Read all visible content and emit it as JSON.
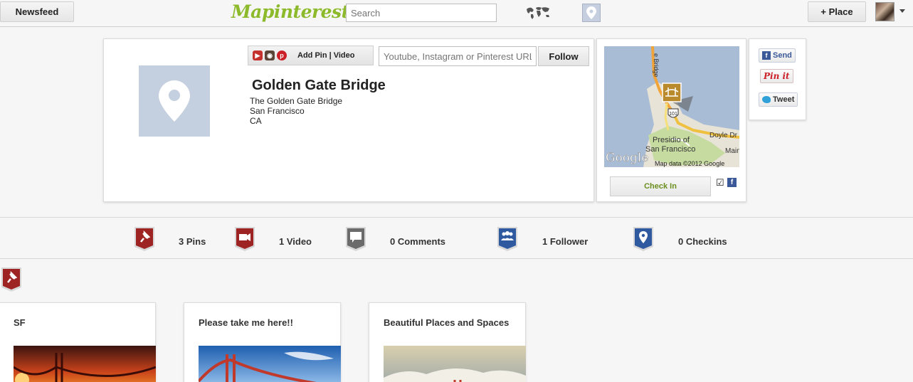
{
  "topbar": {
    "newsfeed_label": "Newsfeed",
    "logo_text": "Mapinterest",
    "search_placeholder": "Search",
    "add_place_label": "+ Place"
  },
  "place": {
    "addpin_label": "Add Pin | Video",
    "url_placeholder": "Youtube, Instagram or Pinterest URL",
    "follow_label": "Follow",
    "title": "Golden Gate Bridge",
    "address": [
      "The Golden Gate Bridge",
      "San Francisco",
      "CA"
    ]
  },
  "map": {
    "labels": {
      "bridge": "e Bridge",
      "presidio": "Presidio of",
      "sf": "San Francisco",
      "doyle": "Doyle Dr",
      "main": "Main",
      "route": "101",
      "google": "Google",
      "credit": "Map data ©2012 Google"
    },
    "checkin_label": "Check In"
  },
  "social": {
    "send_label": "Send",
    "pinit_label": "Pin it",
    "tweet_label": "Tweet"
  },
  "stats": [
    {
      "label": "3 Pins",
      "icon": "pin-icon",
      "color": "#9e2424"
    },
    {
      "label": "1 Video",
      "icon": "video-icon",
      "color": "#9e2424"
    },
    {
      "label": "0 Comments",
      "icon": "comment-icon",
      "color": "#6b6b6b"
    },
    {
      "label": "1 Follower",
      "icon": "followers-icon",
      "color": "#2f5aa0"
    },
    {
      "label": "0 Checkins",
      "icon": "location-icon",
      "color": "#2f5aa0"
    }
  ],
  "boards": [
    {
      "title": "SF"
    },
    {
      "title": "Please take me here!!"
    },
    {
      "title": "Beautiful Places and Spaces"
    }
  ],
  "colors": {
    "brand": "#8cba2a",
    "pin_red": "#9e2424",
    "blue": "#2f5aa0"
  }
}
